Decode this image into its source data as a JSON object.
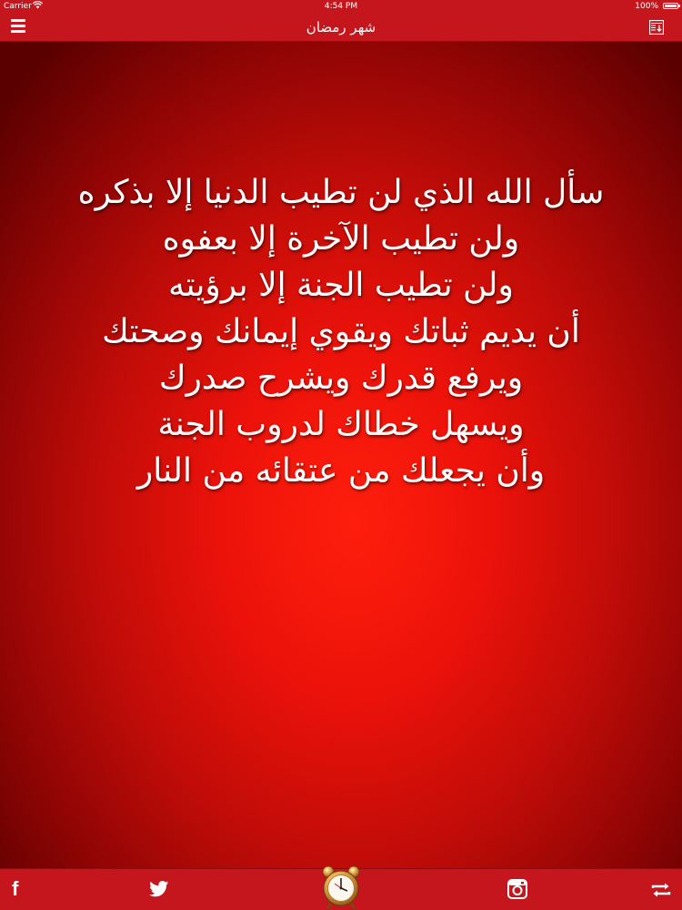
{
  "status_bar": {
    "carrier": "Carrier",
    "time": "4:54 PM",
    "battery": "100%"
  },
  "nav_bar": {
    "title": "شهر رمضان",
    "left_icon": "menu-icon",
    "right_icon": "save-download-icon"
  },
  "poem": {
    "lines": [
      "سأل الله الذي لن تطيب الدنيا إلا بذكره",
      "ولن تطيب الآخرة إلا بعفوه",
      "ولن تطيب الجنة إلا برؤيته",
      "أن يديم ثباتك ويقوي إيمانك وصحتك",
      "ويرفع قدرك ويشرح صدرك",
      "ويسهل خطاك لدروب الجنة",
      "وأن يجعلك من عتقائه من النار"
    ]
  },
  "tab_bar": {
    "icons": [
      "facebook-icon",
      "twitter-icon",
      "alarm-clock-icon",
      "instagram-icon",
      "repeat-icon"
    ]
  },
  "colors": {
    "bar_red": "#c4161c",
    "background_center": "#ff1e0c",
    "background_edge": "#5a0000",
    "text": "#ffffff"
  }
}
